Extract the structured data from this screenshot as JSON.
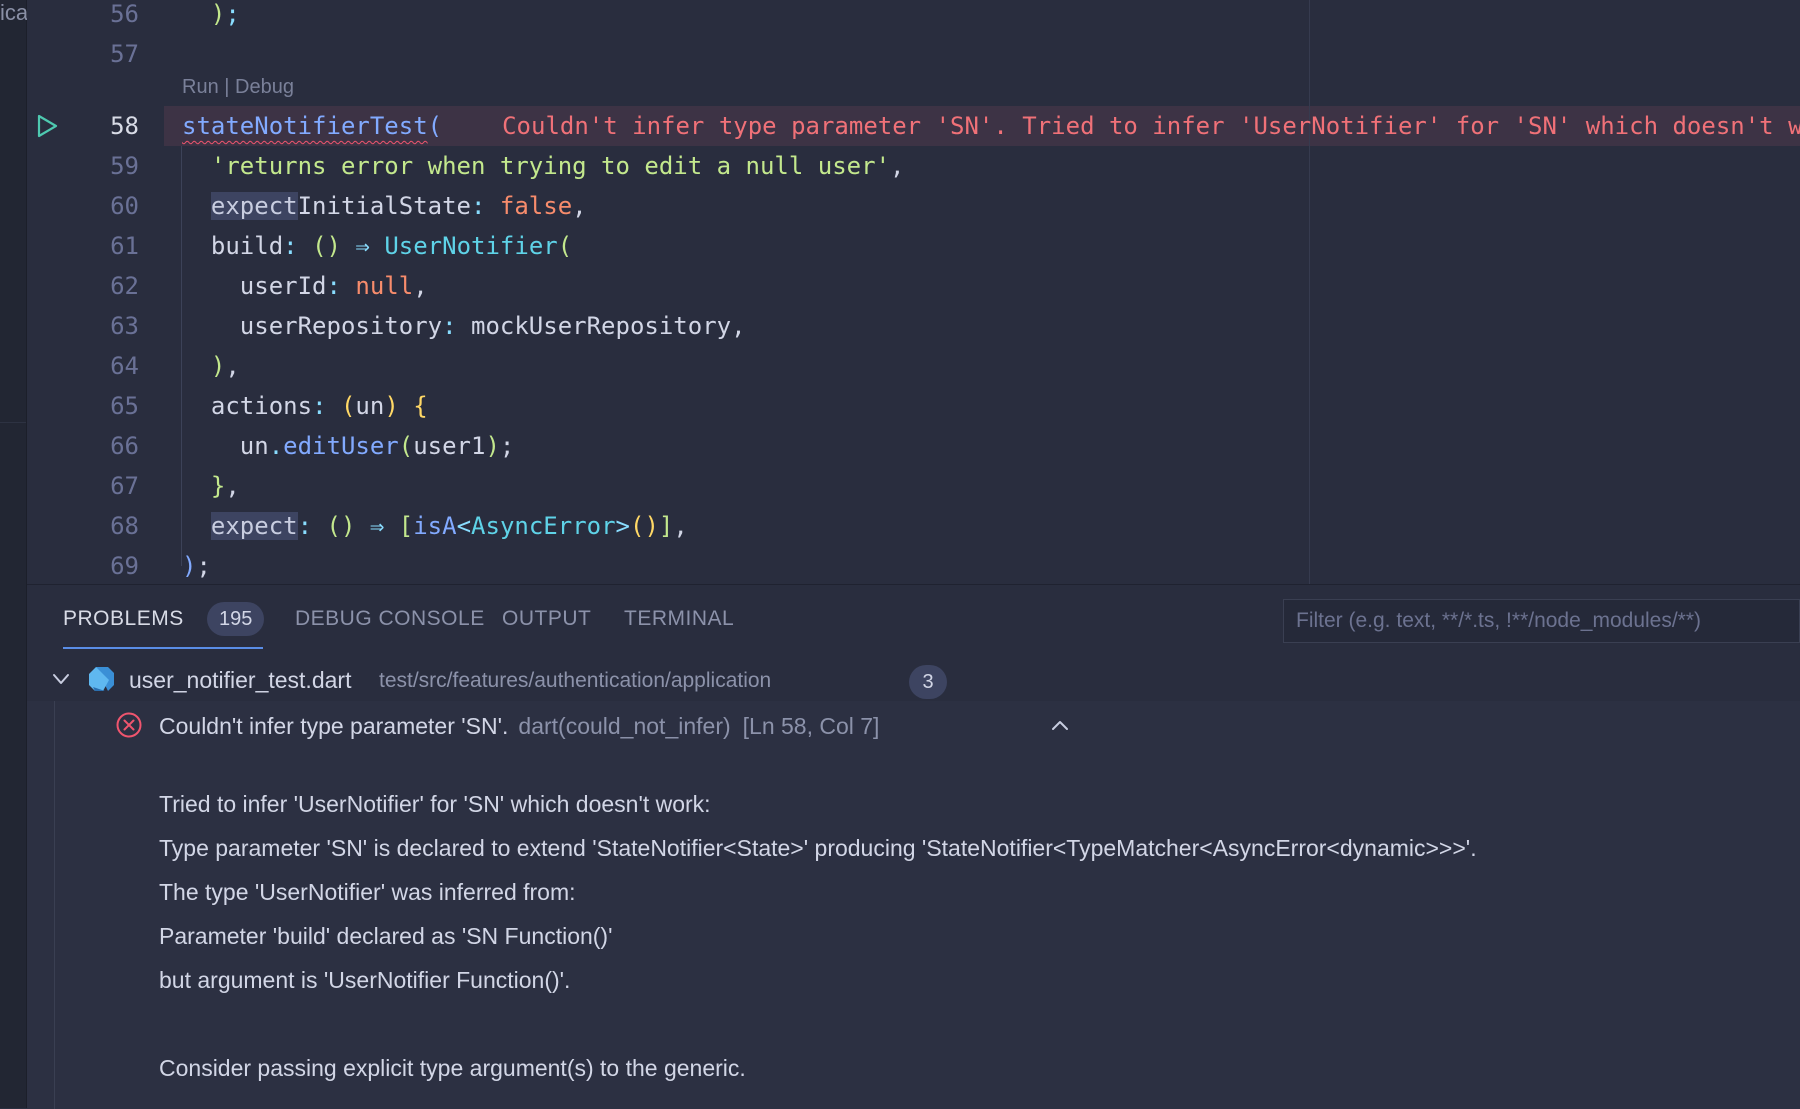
{
  "left_stub": "ica",
  "editor": {
    "codelens": {
      "run": "Run",
      "separator": " | ",
      "debug": "Debug"
    },
    "lines": [
      {
        "num": "56",
        "tokens": [
          {
            "t": "  ",
            "c": "plain"
          },
          {
            "t": ")",
            "c": "paren2"
          },
          {
            "t": ";",
            "c": "punct"
          }
        ]
      },
      {
        "num": "57",
        "tokens": []
      },
      {
        "num": "58",
        "active": true,
        "tokens": [
          {
            "t": "stateNotifierTest",
            "c": "squiggle"
          },
          {
            "t": "(",
            "c": "paren3"
          }
        ]
      },
      {
        "num": "59",
        "tokens": [
          {
            "t": "  ",
            "c": "plain"
          },
          {
            "t": "'returns error when trying to edit a null user'",
            "c": "string"
          },
          {
            "t": ",",
            "c": "plain"
          }
        ]
      },
      {
        "num": "60",
        "tokens": [
          {
            "t": "  ",
            "c": "plain"
          },
          {
            "t": "expect",
            "c": "sel"
          },
          {
            "t": "InitialState",
            "c": "plain"
          },
          {
            "t": ": ",
            "c": "punct"
          },
          {
            "t": "false",
            "c": "kw"
          },
          {
            "t": ",",
            "c": "plain"
          }
        ]
      },
      {
        "num": "61",
        "tokens": [
          {
            "t": "  ",
            "c": "plain"
          },
          {
            "t": "build",
            "c": "plain"
          },
          {
            "t": ": ",
            "c": "punct"
          },
          {
            "t": "()",
            "c": "paren2"
          },
          {
            "t": " ⇒ ",
            "c": "punct"
          },
          {
            "t": "UserNotifier",
            "c": "type"
          },
          {
            "t": "(",
            "c": "paren2"
          }
        ]
      },
      {
        "num": "62",
        "tokens": [
          {
            "t": "    ",
            "c": "plain"
          },
          {
            "t": "userId",
            "c": "plain"
          },
          {
            "t": ": ",
            "c": "punct"
          },
          {
            "t": "null",
            "c": "kw"
          },
          {
            "t": ",",
            "c": "plain"
          }
        ]
      },
      {
        "num": "63",
        "tokens": [
          {
            "t": "    ",
            "c": "plain"
          },
          {
            "t": "userRepository",
            "c": "plain"
          },
          {
            "t": ": ",
            "c": "punct"
          },
          {
            "t": "mockUserRepository",
            "c": "plain"
          },
          {
            "t": ",",
            "c": "plain"
          }
        ]
      },
      {
        "num": "64",
        "tokens": [
          {
            "t": "  ",
            "c": "plain"
          },
          {
            "t": ")",
            "c": "paren2"
          },
          {
            "t": ",",
            "c": "plain"
          }
        ]
      },
      {
        "num": "65",
        "tokens": [
          {
            "t": "  ",
            "c": "plain"
          },
          {
            "t": "actions",
            "c": "plain"
          },
          {
            "t": ": ",
            "c": "punct"
          },
          {
            "t": "(",
            "c": "paren1"
          },
          {
            "t": "un",
            "c": "plain"
          },
          {
            "t": ") ",
            "c": "paren1"
          },
          {
            "t": "{",
            "c": "paren1"
          }
        ]
      },
      {
        "num": "66",
        "tokens": [
          {
            "t": "    ",
            "c": "plain"
          },
          {
            "t": "un",
            "c": "plain"
          },
          {
            "t": ".",
            "c": "punct"
          },
          {
            "t": "editUser",
            "c": "fn"
          },
          {
            "t": "(",
            "c": "paren2"
          },
          {
            "t": "user1",
            "c": "plain"
          },
          {
            "t": ")",
            "c": "paren2"
          },
          {
            "t": ";",
            "c": "plain"
          }
        ]
      },
      {
        "num": "67",
        "tokens": [
          {
            "t": "  ",
            "c": "plain"
          },
          {
            "t": "}",
            "c": "paren2"
          },
          {
            "t": ",",
            "c": "plain"
          }
        ]
      },
      {
        "num": "68",
        "tokens": [
          {
            "t": "  ",
            "c": "plain"
          },
          {
            "t": "expect",
            "c": "sel"
          },
          {
            "t": ": ",
            "c": "punct"
          },
          {
            "t": "()",
            "c": "paren2"
          },
          {
            "t": " ⇒ ",
            "c": "punct"
          },
          {
            "t": "[",
            "c": "paren2"
          },
          {
            "t": "isA",
            "c": "fn"
          },
          {
            "t": "<",
            "c": "punct"
          },
          {
            "t": "AsyncError",
            "c": "type"
          },
          {
            "t": ">",
            "c": "punct"
          },
          {
            "t": "()",
            "c": "paren1"
          },
          {
            "t": "]",
            "c": "paren2"
          },
          {
            "t": ",",
            "c": "plain"
          }
        ]
      },
      {
        "num": "69",
        "tokens": [
          {
            "t": ")",
            "c": "paren3"
          },
          {
            "t": ";",
            "c": "plain"
          }
        ]
      }
    ],
    "inline_error": "Couldn't infer type parameter 'SN'. Tried to infer 'UserNotifier' for 'SN' which doesn't work:"
  },
  "panel": {
    "tabs": [
      {
        "label": "PROBLEMS",
        "active": true
      },
      {
        "label": "DEBUG CONSOLE"
      },
      {
        "label": "OUTPUT"
      },
      {
        "label": "TERMINAL"
      }
    ],
    "problems_count": "195",
    "filter_placeholder": "Filter (e.g. text, **/*.ts, !**/node_modules/**)",
    "file": {
      "name": "user_notifier_test.dart",
      "path": "test/src/features/authentication/application",
      "count": "3"
    },
    "problem": {
      "message": "Couldn't infer type parameter 'SN'.",
      "source": "dart(could_not_infer)",
      "location": "[Ln 58, Col 7]",
      "details": [
        "Tried to infer 'UserNotifier' for 'SN' which doesn't work:",
        "Type parameter 'SN' is declared to extend 'StateNotifier<State>' producing 'StateNotifier<TypeMatcher<AsyncError<dynamic>>>'.",
        "The type 'UserNotifier' was inferred from:",
        "Parameter 'build' declared as 'SN Function()'",
        "but argument is 'UserNotifier Function()'."
      ],
      "suggestion": "Consider passing explicit type argument(s) to the generic."
    }
  },
  "colors": {
    "accent": "#5a8de6",
    "error": "#f07178",
    "error_icon": "#f0556e",
    "run_icon": "#4ec9b0"
  },
  "icons": [
    "play-icon",
    "chevron-down-icon",
    "dart-icon",
    "error-circle-icon",
    "caret-up-icon"
  ]
}
